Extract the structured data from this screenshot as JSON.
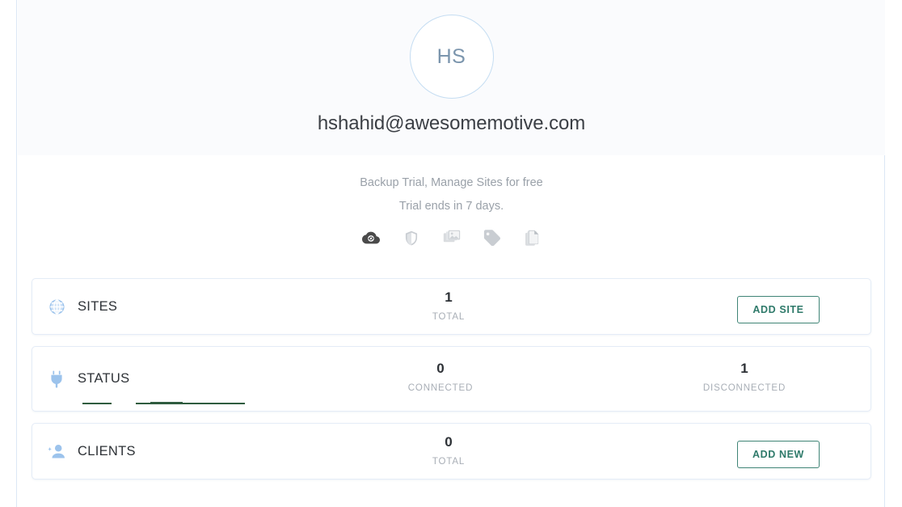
{
  "profile": {
    "initials": "HS",
    "email": "hshahid@awesomemotive.com",
    "avatar_border_color": "#c5ddf2"
  },
  "trial": {
    "headline": "Backup Trial, Manage Sites for free",
    "subline": "Trial ends in 7 days.",
    "feature_icons": [
      {
        "name": "cloud-sync-icon",
        "active": true,
        "color": "#4a4a4a"
      },
      {
        "name": "shield-icon",
        "active": false,
        "color": "#c9cdd2"
      },
      {
        "name": "image-gallery-icon",
        "active": false,
        "color": "#c9cdd2"
      },
      {
        "name": "tag-icon",
        "active": false,
        "color": "#c9cdd2"
      },
      {
        "name": "document-icon",
        "active": false,
        "color": "#c9cdd2"
      }
    ]
  },
  "cards": {
    "sites": {
      "title": "SITES",
      "icon": "globe-icon",
      "icon_color": "#9cc3ec",
      "total_value": "1",
      "total_caption": "TOTAL",
      "button_label": "ADD SITE"
    },
    "status": {
      "title": "STATUS",
      "icon": "power-plug-icon",
      "icon_color": "#9cc3ec",
      "connected_value": "0",
      "connected_caption": "CONNECTED",
      "disconnected_value": "1",
      "disconnected_caption": "DISCONNECTED"
    },
    "clients": {
      "title": "CLIENTS",
      "icon": "add-person-icon",
      "icon_color": "#9cc3ec",
      "total_value": "0",
      "total_caption": "TOTAL",
      "button_label": "ADD NEW"
    }
  },
  "theme": {
    "accent_teal": "#2f7a6a",
    "header_bg": "#fafbfd",
    "card_border": "#e4ecf7",
    "panel_border": "#dce7f5"
  }
}
